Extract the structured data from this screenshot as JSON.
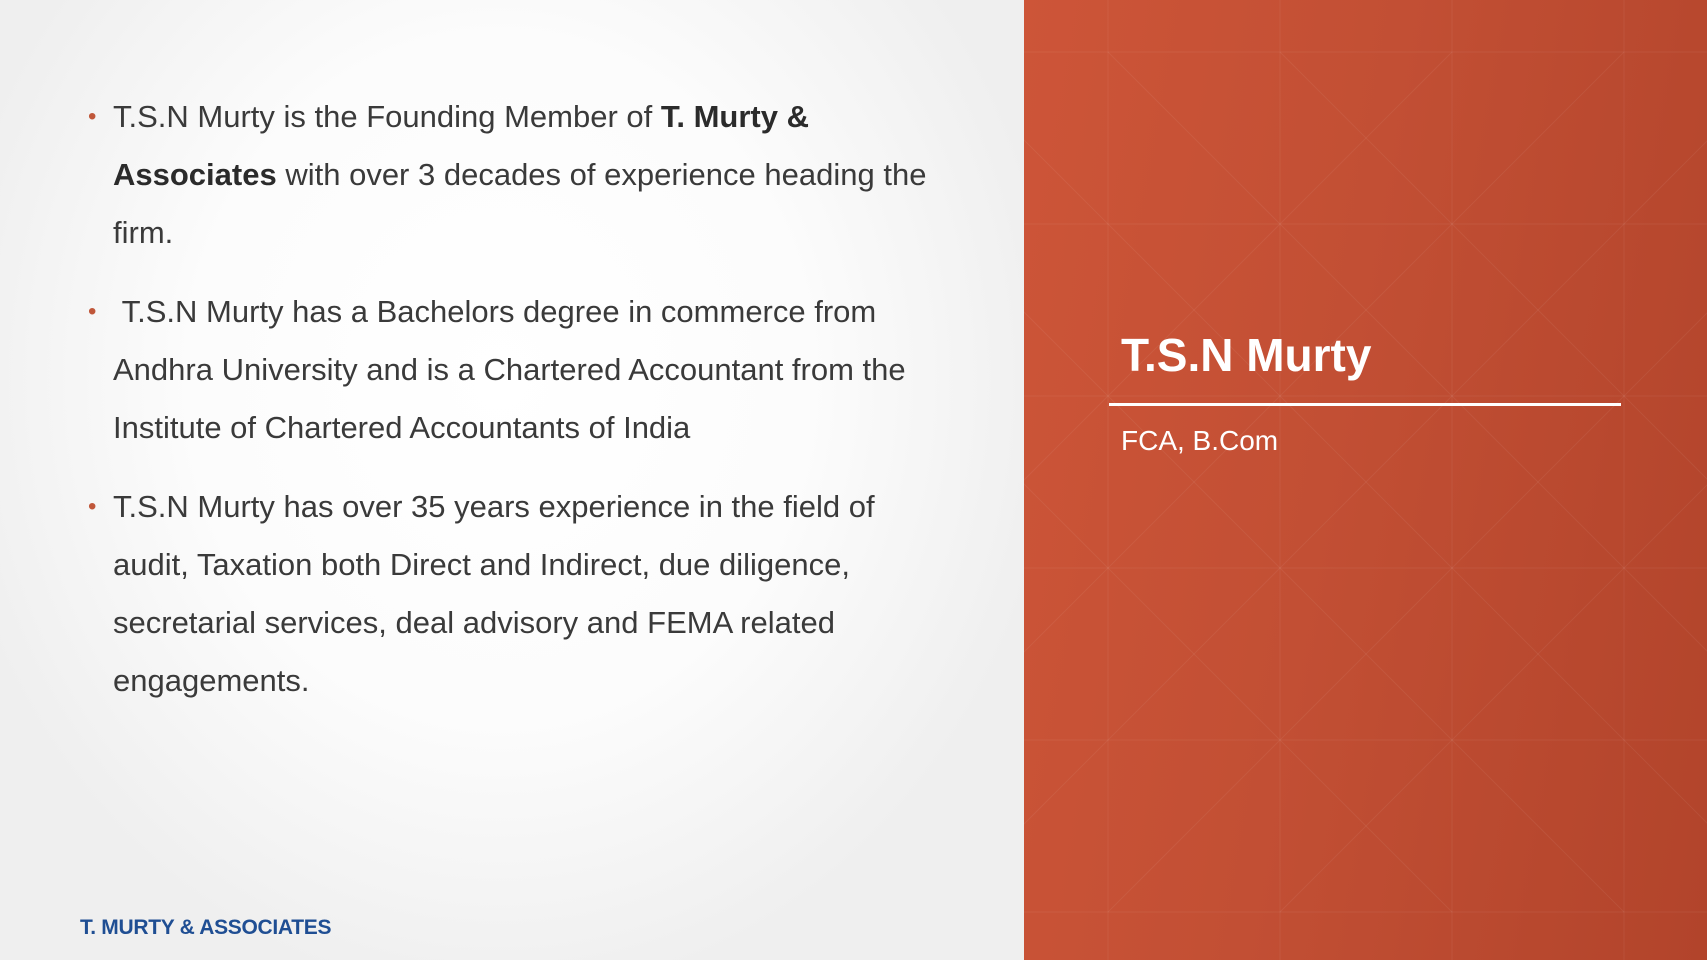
{
  "content": {
    "bullets": [
      {
        "parts": [
          {
            "text": "T.S.N Murty is the Founding Member of ",
            "bold": false
          },
          {
            "text": "T. Murty & Associates",
            "bold": true
          },
          {
            "text": " with over 3 decades of experience heading the firm.",
            "bold": false
          }
        ]
      },
      {
        "parts": [
          {
            "text": " T.S.N Murty has a Bachelors degree in commerce from Andhra University and is a Chartered Accountant from the Institute of Chartered Accountants of India",
            "bold": false
          }
        ]
      },
      {
        "parts": [
          {
            "text": "T.S.N Murty has over 35 years experience in the field of audit, Taxation both Direct and Indirect, due diligence, secretarial services, deal advisory and FEMA related engagements.",
            "bold": false
          }
        ]
      }
    ],
    "bullet_symbol": "•"
  },
  "footer": {
    "logo_text": "T. MURTY & ASSOCIATES"
  },
  "profile": {
    "name": "T.S.N Murty",
    "credentials": "FCA, B.Com"
  },
  "colors": {
    "accent_panel": "#c24f34",
    "bullet": "#c0573a",
    "logo": "#1f4e93",
    "body_text": "#3a3a3a"
  }
}
